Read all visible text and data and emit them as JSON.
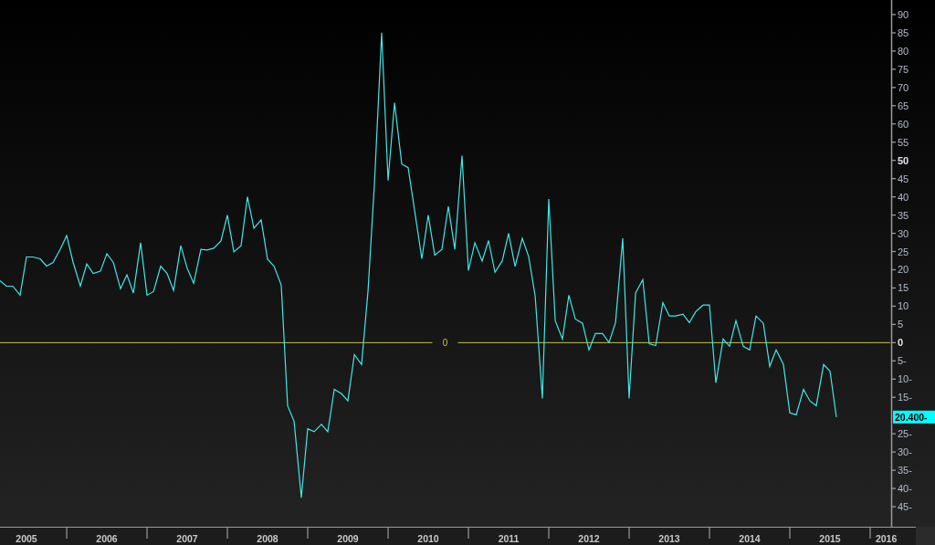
{
  "chart_data": {
    "type": "line",
    "xlim": [
      2005.17,
      2016.25
    ],
    "ylim": [
      -50.5,
      94
    ],
    "xticks": [
      {
        "value": 2005.5,
        "label": "2005"
      },
      {
        "value": 2006.5,
        "label": "2006"
      },
      {
        "value": 2007.5,
        "label": "2007"
      },
      {
        "value": 2008.5,
        "label": "2008"
      },
      {
        "value": 2009.5,
        "label": "2009"
      },
      {
        "value": 2010.5,
        "label": "2010"
      },
      {
        "value": 2011.5,
        "label": "2011"
      },
      {
        "value": 2012.5,
        "label": "2012"
      },
      {
        "value": 2013.5,
        "label": "2013"
      },
      {
        "value": 2014.5,
        "label": "2014"
      },
      {
        "value": 2015.5,
        "label": "2015"
      },
      {
        "value": 2016.2,
        "label": "2016"
      }
    ],
    "yticks": [
      {
        "value": -45,
        "label": "45-"
      },
      {
        "value": -40,
        "label": "40-"
      },
      {
        "value": -35,
        "label": "35-"
      },
      {
        "value": -30,
        "label": "30-"
      },
      {
        "value": -25,
        "label": "25-"
      },
      {
        "value": -15,
        "label": "15-"
      },
      {
        "value": -10,
        "label": "10-"
      },
      {
        "value": -5,
        "label": "5-"
      },
      {
        "value": 0,
        "label": "0"
      },
      {
        "value": 5,
        "label": "5"
      },
      {
        "value": 10,
        "label": "10"
      },
      {
        "value": 15,
        "label": "15"
      },
      {
        "value": 20,
        "label": "20"
      },
      {
        "value": 25,
        "label": "25"
      },
      {
        "value": 30,
        "label": "30"
      },
      {
        "value": 35,
        "label": "35"
      },
      {
        "value": 40,
        "label": "40"
      },
      {
        "value": 45,
        "label": "45"
      },
      {
        "value": 50,
        "label": "50"
      },
      {
        "value": 55,
        "label": "55"
      },
      {
        "value": 60,
        "label": "60"
      },
      {
        "value": 65,
        "label": "65"
      },
      {
        "value": 70,
        "label": "70"
      },
      {
        "value": 75,
        "label": "75"
      },
      {
        "value": 80,
        "label": "80"
      },
      {
        "value": 85,
        "label": "85"
      },
      {
        "value": 90,
        "label": "90"
      }
    ],
    "x": [
      2005.17,
      2005.25,
      2005.33,
      2005.42,
      2005.5,
      2005.58,
      2005.67,
      2005.75,
      2005.83,
      2005.92,
      2006,
      2006.08,
      2006.17,
      2006.25,
      2006.33,
      2006.42,
      2006.5,
      2006.58,
      2006.67,
      2006.75,
      2006.83,
      2006.92,
      2007,
      2007.08,
      2007.17,
      2007.25,
      2007.33,
      2007.42,
      2007.5,
      2007.58,
      2007.67,
      2007.75,
      2007.83,
      2007.92,
      2008,
      2008.08,
      2008.17,
      2008.25,
      2008.33,
      2008.42,
      2008.5,
      2008.58,
      2008.67,
      2008.75,
      2008.83,
      2008.92,
      2009,
      2009.08,
      2009.17,
      2009.25,
      2009.33,
      2009.42,
      2009.5,
      2009.58,
      2009.67,
      2009.75,
      2009.83,
      2009.92,
      2010,
      2010.08,
      2010.17,
      2010.25,
      2010.33,
      2010.42,
      2010.5,
      2010.58,
      2010.67,
      2010.75,
      2010.83,
      2010.92,
      2011,
      2011.08,
      2011.17,
      2011.25,
      2011.33,
      2011.42,
      2011.5,
      2011.58,
      2011.67,
      2011.75,
      2011.83,
      2011.92,
      2012,
      2012.08,
      2012.17,
      2012.25,
      2012.33,
      2012.42,
      2012.5,
      2012.58,
      2012.67,
      2012.75,
      2012.83,
      2012.92,
      2013,
      2013.08,
      2013.17,
      2013.25,
      2013.33,
      2013.42,
      2013.5,
      2013.58,
      2013.67,
      2013.75,
      2013.83,
      2013.92,
      2014,
      2014.08,
      2014.17,
      2014.25,
      2014.33,
      2014.42,
      2014.5,
      2014.58,
      2014.67,
      2014.75,
      2014.83,
      2014.92,
      2015,
      2015.08,
      2015.17,
      2015.25,
      2015.33,
      2015.42,
      2015.5,
      2015.58
    ],
    "series": [
      {
        "color": "#40e8e8",
        "values": [
          17,
          15.5,
          15.5,
          13,
          23.5,
          23.5,
          23,
          21,
          22,
          25.6,
          29.4,
          22,
          15.5,
          21.6,
          19,
          19.6,
          24.4,
          22,
          14.8,
          18.6,
          13.6,
          27.4,
          13,
          14,
          21,
          19,
          14.3,
          26.6,
          20.4,
          16.3,
          25.6,
          25.4,
          25.9,
          27.9,
          35,
          24.9,
          26.6,
          40,
          31.4,
          33.7,
          22.9,
          21,
          15.8,
          -17.3,
          -21.6,
          -42.5,
          -23.6,
          -24.4,
          -22.4,
          -24.4,
          -12.8,
          -14,
          -16,
          -3.3,
          -6,
          14,
          43.7,
          85,
          44.5,
          65.8,
          49,
          48,
          36.2,
          23,
          35,
          24,
          25.6,
          37.4,
          25.6,
          51.3,
          19.8,
          27.4,
          22.4,
          28,
          19.3,
          22.4,
          30,
          20.9,
          28.6,
          23.6,
          12.8,
          -15.3,
          39.4,
          6,
          1,
          13,
          6.5,
          5.3,
          -2,
          2.5,
          2.5,
          0,
          5.5,
          28.6,
          -15.3,
          13.6,
          17.3,
          -0.3,
          -0.8,
          11,
          7.3,
          7.3,
          7.8,
          5.5,
          8.5,
          10.3,
          10.3,
          -11,
          1,
          -1,
          6,
          -1,
          -2,
          7.3,
          5.3,
          -6.5,
          -2,
          -6,
          -19.3,
          -19.8,
          -12.8,
          -16,
          -17.3,
          -6,
          -7.8,
          -20.4
        ]
      }
    ]
  },
  "zero_line": {
    "label": "0"
  },
  "last_value_tag": {
    "label": "20.400-"
  }
}
